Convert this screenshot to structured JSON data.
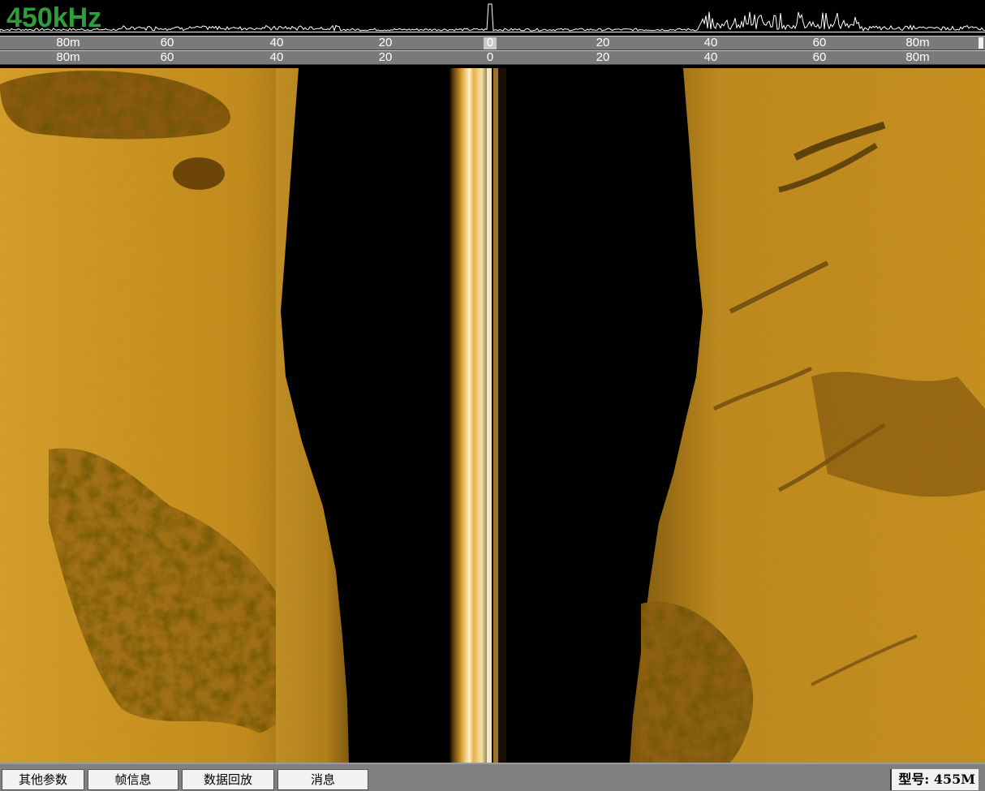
{
  "frequency_label": "450kHz",
  "ruler_top": {
    "labels": [
      "80m",
      "60",
      "40",
      "20",
      "0",
      "20",
      "40",
      "60",
      "80m"
    ]
  },
  "ruler_bottom": {
    "labels": [
      "80m",
      "60",
      "40",
      "20",
      "0",
      "20",
      "40",
      "60",
      "80m"
    ]
  },
  "toolbar": {
    "tabs": [
      {
        "label": "其他参数"
      },
      {
        "label": "帧信息"
      },
      {
        "label": "数据回放"
      },
      {
        "label": "消息"
      }
    ],
    "model_label": "型号: 455M"
  },
  "colors": {
    "sonar_gold": "#c8901e",
    "frequency_text": "#2e9e3a",
    "ruler_bg": "#7a7a7a",
    "toolbar_bg": "#808080"
  }
}
